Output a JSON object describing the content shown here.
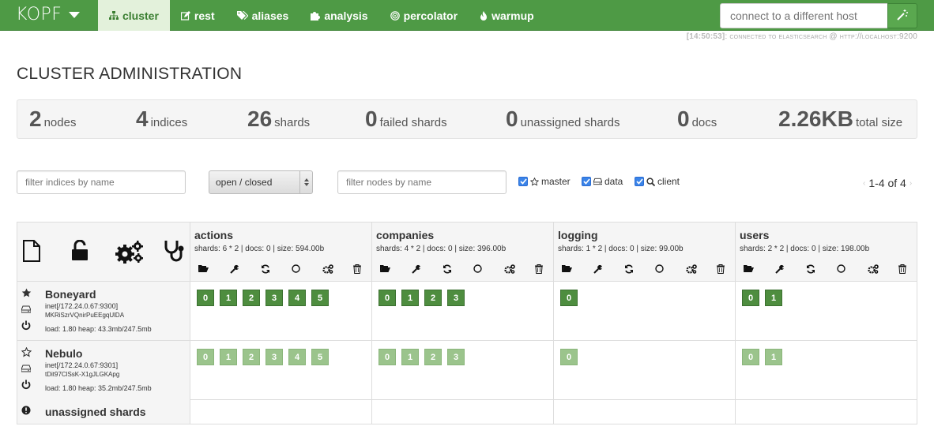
{
  "brand": "KOPF",
  "nav": [
    {
      "label": "cluster",
      "icon": "sitemap-icon",
      "active": true
    },
    {
      "label": "rest",
      "icon": "edit-icon"
    },
    {
      "label": "aliases",
      "icon": "tags-icon"
    },
    {
      "label": "analysis",
      "icon": "puzzle-icon"
    },
    {
      "label": "percolator",
      "icon": "bullseye-icon"
    },
    {
      "label": "warmup",
      "icon": "fire-icon"
    }
  ],
  "host": {
    "placeholder": "connect to a different host",
    "button_icon": "magic-wand-icon"
  },
  "status_line": {
    "time": "[14:50:53]",
    "text": "connected to elasticsearch @ http://localhost:9200"
  },
  "page_title": "CLUSTER ADMINISTRATION",
  "stats": [
    {
      "value": "2",
      "label": "nodes"
    },
    {
      "value": "4",
      "label": "indices"
    },
    {
      "value": "26",
      "label": "shards"
    },
    {
      "value": "0",
      "label": "failed shards"
    },
    {
      "value": "0",
      "label": "unassigned shards"
    },
    {
      "value": "0",
      "label": "docs"
    },
    {
      "value": "2.26KB",
      "label": "total size"
    }
  ],
  "filters": {
    "indices_placeholder": "filter indices by name",
    "state_select": "open / closed",
    "nodes_placeholder": "filter nodes by name",
    "master": {
      "label": "master",
      "checked": true,
      "icon": "star-outline-icon"
    },
    "data": {
      "label": "data",
      "checked": true,
      "icon": "hdd-icon"
    },
    "client": {
      "label": "client",
      "checked": true,
      "icon": "search-icon"
    },
    "pager": "1-4 of 4"
  },
  "header_icons": [
    "new-index-icon",
    "unlock-icon",
    "settings-gears-icon",
    "stethoscope-icon"
  ],
  "indices": [
    {
      "name": "actions",
      "stats": "shards: 6 * 2 | docs: 0 | size: 594.00b"
    },
    {
      "name": "companies",
      "stats": "shards: 4 * 2 | docs: 0 | size: 396.00b"
    },
    {
      "name": "logging",
      "stats": "shards: 1 * 2 | docs: 0 | size: 99.00b"
    },
    {
      "name": "users",
      "stats": "shards: 2 * 2 | docs: 0 | size: 198.00b"
    }
  ],
  "index_actions": [
    "open-folder-icon",
    "wrench-icon",
    "refresh-icon",
    "circle-icon",
    "cogs-icon",
    "trash-icon"
  ],
  "nodes": [
    {
      "name": "Boneyard",
      "address": "inet[/172.24.0.67:9300]",
      "id": "MKRiSzrVQnirPuEEgqUlDA",
      "load": "load: 1.80  heap: 43.3mb/247.5mb",
      "master": true,
      "shards": [
        [
          "0",
          "1",
          "2",
          "3",
          "4",
          "5"
        ],
        [
          "0",
          "1",
          "2",
          "3"
        ],
        [
          "0"
        ],
        [
          "0",
          "1"
        ]
      ],
      "primary": true
    },
    {
      "name": "Nebulo",
      "address": "inet[/172.24.0.67:9301]",
      "id": "tDit97ClSsK-X1gJLGKApg",
      "load": "load: 1.80  heap: 35.2mb/247.5mb",
      "master": false,
      "shards": [
        [
          "0",
          "1",
          "2",
          "3",
          "4",
          "5"
        ],
        [
          "0",
          "1",
          "2",
          "3"
        ],
        [
          "0"
        ],
        [
          "0",
          "1"
        ]
      ],
      "primary": false
    }
  ],
  "unassigned_label": "unassigned shards",
  "colors": {
    "navbar": "#4e9a45",
    "primary_shard": "#4e8d3f",
    "replica_shard": "#9bc48c"
  }
}
